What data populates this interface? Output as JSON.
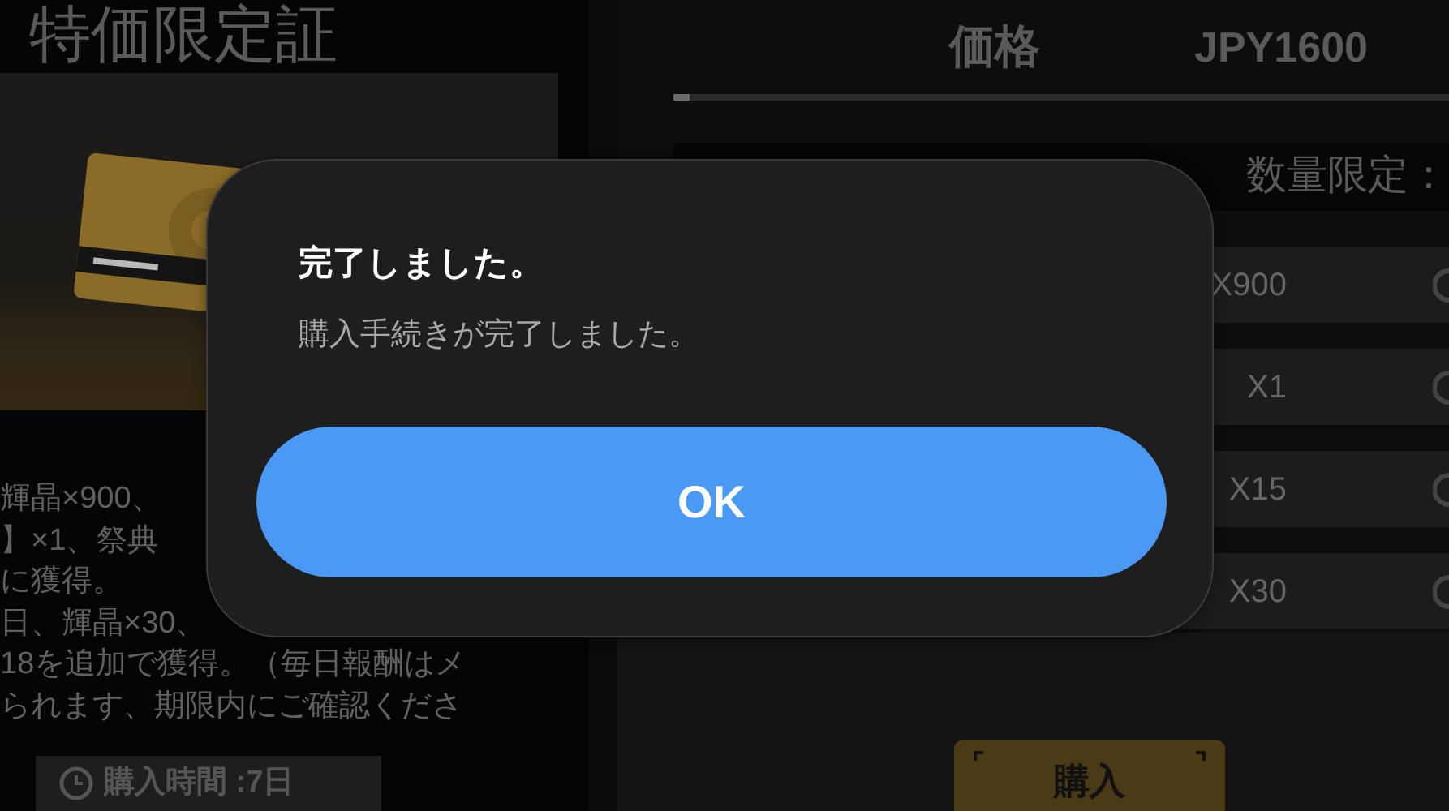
{
  "product": {
    "title": "特価限定証",
    "description": [
      "輝晶×900、",
      "】×1、祭典",
      "に獲得。",
      "日、輝晶×30、",
      "18を追加で獲得。（毎日報酬はメ",
      "られます、期限内にご確認くださ"
    ],
    "purchase_period": "購入時間 :7日"
  },
  "price": {
    "label": "価格",
    "value": "JPY1600",
    "slider": {
      "level": 0.02
    }
  },
  "quantity_limit": "数量限定：",
  "options": [
    {
      "label": "X900",
      "selected": false
    },
    {
      "label": "X1",
      "selected": false
    },
    {
      "label": "X15",
      "selected": false
    },
    {
      "label": "X30",
      "selected": false
    }
  ],
  "buy_button": "購入",
  "dialog": {
    "title": "完了しました。",
    "message": "購入手続きが完了しました。",
    "button": "OK"
  }
}
